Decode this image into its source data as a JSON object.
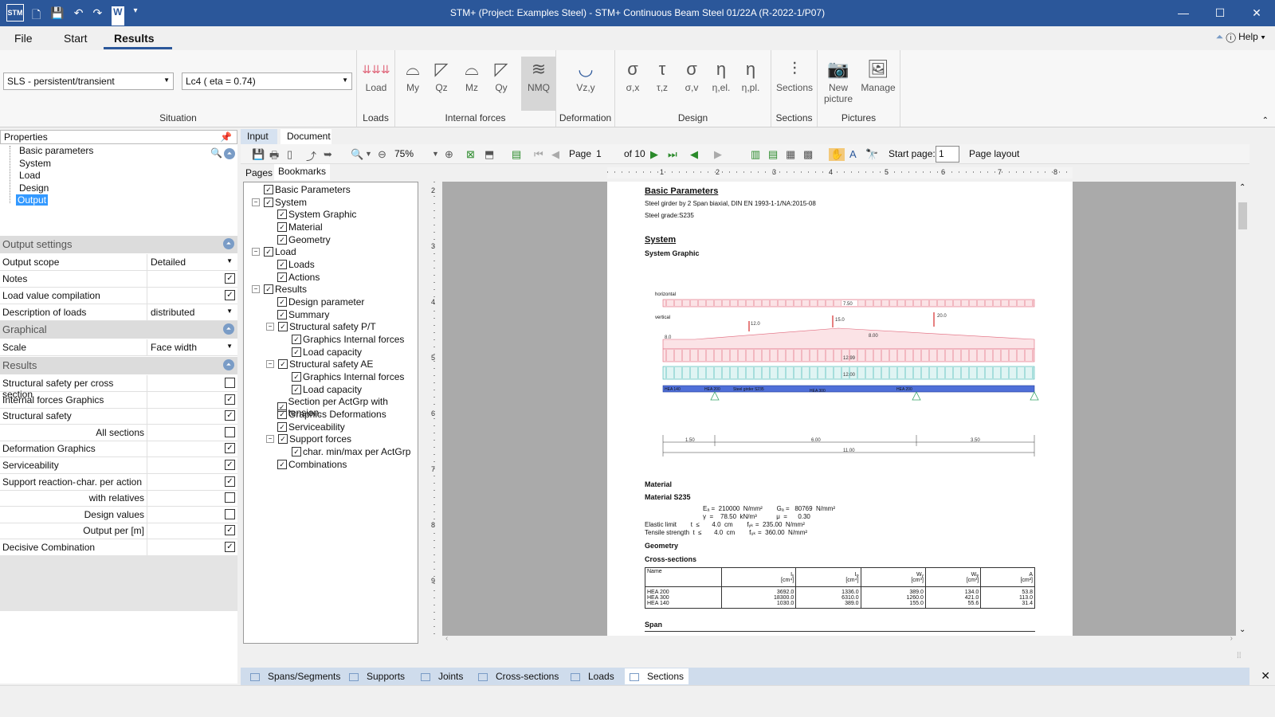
{
  "app": {
    "logo": "STM",
    "title": "STM+ (Project: Examples Steel) - STM+ Continuous Beam Steel 01/22A (R-2022-1/P07)",
    "window_controls": [
      "minimize-icon",
      "maximize-icon",
      "close-icon"
    ]
  },
  "menu": {
    "file": "File",
    "start": "Start",
    "results": "Results",
    "help": "Help"
  },
  "ribbon": {
    "situation_value": "SLS - persistent/transient",
    "loadcase_value": "Lc4  ( eta = 0.74)",
    "groups": {
      "situation": "Situation",
      "loads": "Loads",
      "internal_forces": "Internal forces",
      "deformation": "Deformation",
      "design": "Design",
      "sections": "Sections",
      "pictures": "Pictures"
    },
    "buttons": {
      "load": "Load",
      "my": "My",
      "qz": "Qz",
      "mz": "Mz",
      "qy": "Qy",
      "nmq": "NMQ",
      "vzy": "Vz,y",
      "sigma_x": "σ,x",
      "tau_z": "τ,z",
      "sigma_v": "σ,v",
      "eta_el": "η,el.",
      "eta_pl": "η,pl.",
      "sections": "Sections",
      "new_picture_1": "New",
      "new_picture_2": "picture",
      "manage": "Manage"
    },
    "design_glyphs": [
      "σ",
      "τ",
      "σ",
      "η",
      "η"
    ]
  },
  "properties": {
    "header": "Properties",
    "tree": [
      "Basic parameters",
      "System",
      "Load",
      "Design",
      "Output"
    ],
    "selected": "Output"
  },
  "output_settings": {
    "header": "Output settings",
    "rows": {
      "output_scope": {
        "label": "Output scope",
        "value": "Detailed"
      },
      "notes": {
        "label": "Notes"
      },
      "load_value_compilation": {
        "label": "Load value compilation"
      },
      "description_of_loads": {
        "label": "Description of loads",
        "value": "distributed"
      }
    }
  },
  "graphical": {
    "header": "Graphical",
    "scale": {
      "label": "Scale",
      "value": "Face width"
    }
  },
  "results": {
    "header": "Results",
    "rows": [
      {
        "label": "Structural safety per cross section",
        "checked": false
      },
      {
        "label": "Internal forces Graphics",
        "checked": true
      },
      {
        "label": "Structural safety",
        "checked": true
      },
      {
        "label": "All sections",
        "checked": false
      },
      {
        "label": "Deformation Graphics",
        "checked": true
      },
      {
        "label": "Serviceability",
        "checked": true
      },
      {
        "label": "Support reaction-",
        "label2": "char. per action",
        "checked": true
      },
      {
        "label": "with relatives",
        "checked": false
      },
      {
        "label": "Design values",
        "checked": false
      },
      {
        "label": "Output per [m]",
        "checked": true
      },
      {
        "label": "Decisive Combination",
        "checked": true
      }
    ]
  },
  "doc_tabs": {
    "input": "Input",
    "document": "Document"
  },
  "viewer": {
    "zoom": "75%",
    "page_label": "Page",
    "page": "1",
    "of_pages": "of 10",
    "start_page_label": "Start page:",
    "start_page": "1",
    "page_layout": "Page layout"
  },
  "bm_tabs": {
    "pages": "Pages",
    "bookmarks": "Bookmarks"
  },
  "bookmarks": [
    "Basic Parameters",
    "System",
    "System Graphic",
    "Material",
    "Geometry",
    "Load",
    "Loads",
    "Actions",
    "Results",
    "Design parameter",
    "Summary",
    "Structural safety P/T",
    "Graphics Internal forces",
    "Load capacity",
    "Structural safety AE",
    "Graphics Internal forces",
    "Load capacity",
    "Section per ActGrp with tension.",
    "Graphics Deformations",
    "Serviceability",
    "Support forces",
    "char. min/max per ActGrp",
    "Combinations"
  ],
  "document": {
    "basic_parameters": "Basic Parameters",
    "line1": "Steel girder by 2 Span  biaxial, DIN EN 1993-1-1/NA:2015-08",
    "line2": "Steel grade:S235",
    "system": "System",
    "system_graphic": "System Graphic",
    "horizontal": "horizontal",
    "vertical": "vertical",
    "load_labels": [
      "7.50",
      "12.0",
      "15.0",
      "20.0",
      "8.0",
      "8.00",
      "12.99",
      "12.00"
    ],
    "beam_labels": [
      "HEA 140",
      "HEA 200",
      "Steel girder S235",
      "HEA 300",
      "HEA 200"
    ],
    "dims": [
      "1.50",
      "6.00",
      "3.50",
      "11.00"
    ],
    "material": "Material",
    "material_s235": "Material S235",
    "mat_line1": "Eₐ =  210000  N/mm²        Gₐ =   80769  N/mm²",
    "mat_line2": "γ  =    78.50  kN/m³           μ  =      0.30",
    "mat_line3": "Elastic limit        t  ≤       4.0  cm        fᵧₖ =  235.00  N/mm²",
    "mat_line4": "Tensile strength  t  ≤       4.0  cm        fᵤₖ =  360.00  N/mm²",
    "geometry": "Geometry",
    "cross_sections": "Cross-sections",
    "table_headers": [
      "Name",
      "Iᵧ\n[cm⁴]",
      "Iᵩ\n[cm⁴]",
      "Wᵧ\n[cm³]",
      "Wᵩ\n[cm³]",
      "A\n[cm²]"
    ],
    "table_rows": [
      [
        "HEA 200",
        "3692.0",
        "1336.0",
        "389.0",
        "134.0",
        "53.8"
      ],
      [
        "HEA 300",
        "18300.0",
        "6310.0",
        "1260.0",
        "421.0",
        "113.0"
      ],
      [
        "HEA 140",
        "1030.0",
        "389.0",
        "155.0",
        "55.6",
        "31.4"
      ]
    ],
    "span": "Span"
  },
  "bottom_tabs": [
    "Spans/Segments",
    "Supports",
    "Joints",
    "Cross-sections",
    "Loads",
    "Sections"
  ],
  "bottom_active": "Sections",
  "colors": {
    "accent": "#2b579a",
    "load_red": "#e0667a",
    "load_teal": "#3ab5b0",
    "beam_blue": "#4f6fd8"
  }
}
